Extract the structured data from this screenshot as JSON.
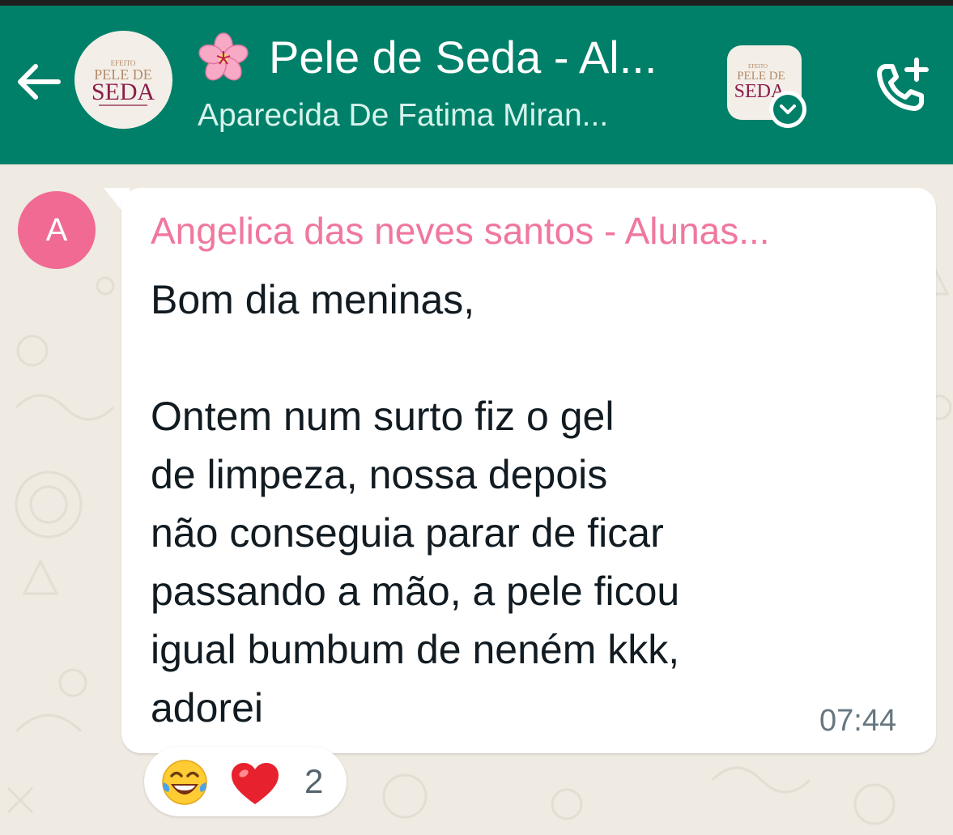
{
  "header": {
    "back_icon": "arrow-left-icon",
    "group_logo": {
      "small_text": "EFEITO",
      "line1": "PELE DE",
      "line2": "SEDA"
    },
    "title_icon": "cherry-blossom-icon",
    "title": "Pele de Seda - Al...",
    "subtitle": "Aparecida De Fatima Miran...",
    "community_logo": {
      "small_text": "EFEITO",
      "line1": "PELE DE",
      "line2": "SEDA"
    },
    "community_badge_icon": "chevron-down-icon",
    "call_icon": "add-call-icon"
  },
  "message": {
    "avatar_letter": "A",
    "sender": "Angelica das neves santos - Alunas...",
    "body": "Bom dia meninas,\n\nOntem num surto fiz o gel\nde limpeza, nossa depois\nnão conseguia parar de ficar\npassando a mão,  a pele ficou\nigual bumbum de neném kkk,\nadorei",
    "time": "07:44"
  },
  "reactions": {
    "emojis": [
      "laughing-tears-icon",
      "red-heart-icon"
    ],
    "count": "2"
  },
  "colors": {
    "header": "#008069",
    "wallpaper": "#efeae2",
    "sender_name": "#f0779d",
    "avatar": "#f06a94",
    "logo_brand": "#8b1d4b"
  }
}
